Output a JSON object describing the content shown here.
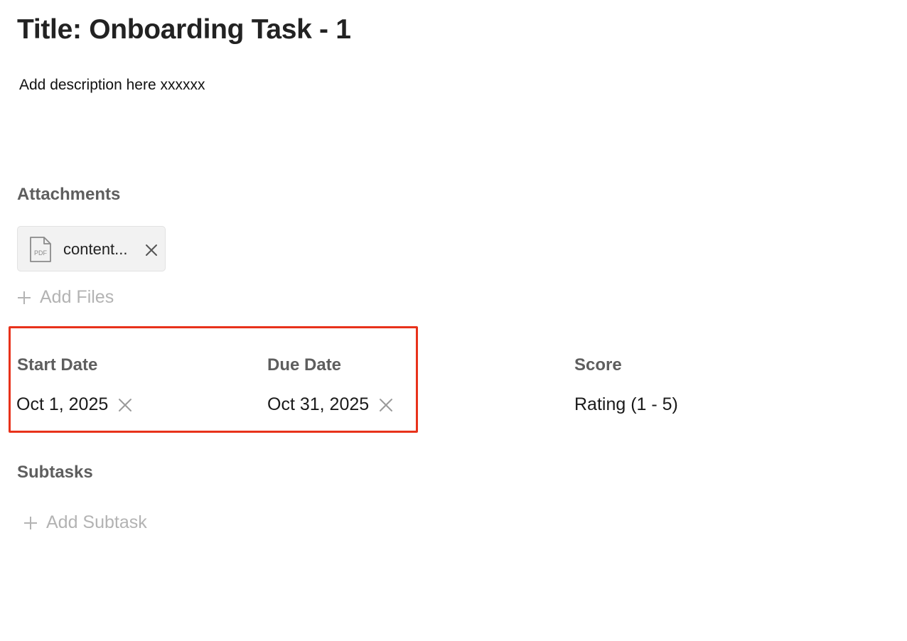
{
  "task": {
    "title": "Title: Onboarding Task - 1",
    "description": "Add description here xxxxxx"
  },
  "attachments": {
    "heading": "Attachments",
    "files": [
      {
        "name": "content...",
        "type_label": "PDF",
        "icon": "pdf-file-icon"
      }
    ],
    "add_label": "Add Files"
  },
  "dates": {
    "start_label": "Start Date",
    "start_value": "Oct 1, 2025",
    "due_label": "Due Date",
    "due_value": "Oct 31, 2025"
  },
  "score": {
    "label": "Score",
    "value": "Rating (1 - 5)"
  },
  "subtasks": {
    "heading": "Subtasks",
    "add_label": "Add Subtask"
  },
  "colors": {
    "highlight": "#e8321b",
    "heading": "#5e5e5e",
    "muted": "#b3b3b3"
  }
}
